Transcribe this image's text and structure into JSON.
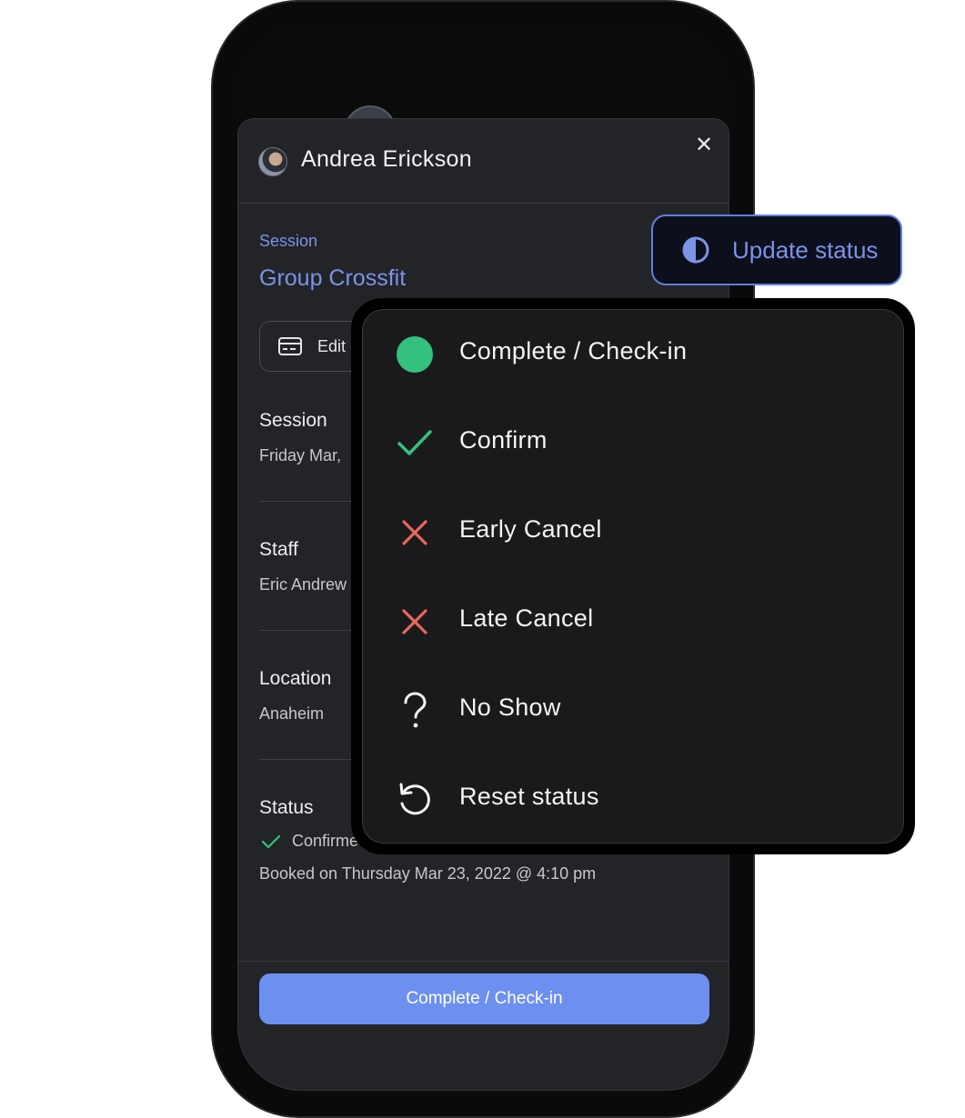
{
  "sheet": {
    "user_name": "Andrea Erickson",
    "close_glyph": "✕",
    "session_kicker": "Session",
    "session_title": "Group Crossfit",
    "edit_label": "Edit",
    "fields": [
      {
        "label": "Session",
        "value": "Friday Mar,"
      },
      {
        "label": "Staff",
        "value": "Eric Andrew"
      },
      {
        "label": "Location",
        "value": "Anaheim"
      }
    ],
    "status_label": "Status",
    "status_value": "Confirme",
    "booked": "Booked on Thursday Mar 23, 2022 @ 4:10 pm",
    "primary_button": "Complete / Check-in"
  },
  "update_status": {
    "label": "Update status",
    "icon": "half-circle-icon"
  },
  "menu": {
    "items": [
      {
        "label": "Complete / Check-in",
        "icon": "green-dot-icon"
      },
      {
        "label": "Confirm",
        "icon": "check-icon"
      },
      {
        "label": "Early Cancel",
        "icon": "x-icon"
      },
      {
        "label": "Late Cancel",
        "icon": "x-icon"
      },
      {
        "label": "No Show",
        "icon": "question-icon"
      },
      {
        "label": "Reset status",
        "icon": "reset-icon"
      }
    ]
  },
  "colors": {
    "accent": "#6d8ff0",
    "success": "#34c07f",
    "danger": "#e8685c",
    "sheet_bg": "#232427",
    "menu_bg": "#1a1a1c"
  }
}
